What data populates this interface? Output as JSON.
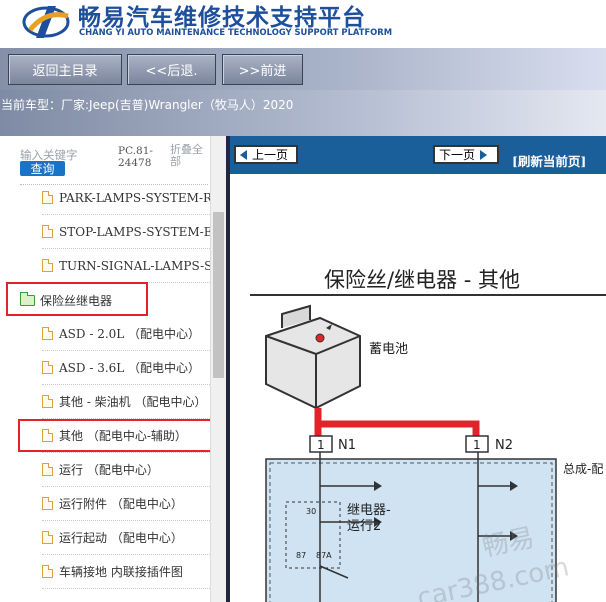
{
  "header": {
    "title": "畅易汽车维修技术支持平台",
    "subtitle": "CHANG YI AUTO MAINTENANCE TECHNOLOGY SUPPORT PLATFORM"
  },
  "toolbar": {
    "home_label": "返回主目录",
    "back_label": "<<后退.",
    "forward_label": ">>前进"
  },
  "model": {
    "prefix": "当前车型：",
    "text": "厂家:Jeep(吉普)Wrangler（牧马人）2020"
  },
  "search": {
    "label": "输入关键字",
    "code": "PC.81-24478",
    "collapse_label": "折叠全部",
    "query_label": "查询"
  },
  "tree": {
    "items": [
      {
        "label": "PARK-LAMPS-SYSTEM-R"
      },
      {
        "label": "STOP-LAMPS-SYSTEM-EX"
      },
      {
        "label": "TURN-SIGNAL-LAMPS-SY"
      },
      {
        "label": "保险丝继电器",
        "type": "folder"
      },
      {
        "label": "ASD - 2.0L （配电中心）"
      },
      {
        "label": "ASD - 3.6L （配电中心）"
      },
      {
        "label": "其他 - 柴油机 （配电中心）"
      },
      {
        "label": "其他 （配电中心-辅助）"
      },
      {
        "label": "运行 （配电中心）"
      },
      {
        "label": "运行附件 （配电中心）"
      },
      {
        "label": "运行起动 （配电中心）"
      },
      {
        "label": "车辆接地 内联接插件图"
      }
    ]
  },
  "nav": {
    "prev_label": "上一页",
    "next_label": "下一页",
    "refresh_label": "[刷新当前页]"
  },
  "diagram": {
    "title": "保险丝/继电器 - 其他",
    "battery_label": "蓄电池",
    "node1": "N1",
    "node2": "N2",
    "pin1": "1",
    "pin2": "1",
    "assembly_label": "总成-配",
    "relay_label_1": "继电器-",
    "relay_label_2": "运行2",
    "pin30": "30",
    "pin87": "87",
    "pin87a": "87A"
  },
  "watermark": {
    "line1": "畅易",
    "line2": "car388.com"
  },
  "colors": {
    "brand_blue": "#1d4f9c",
    "nav_blue": "#1a5e9a",
    "highlight_red": "#e0242a",
    "wire_red": "#e0242a"
  }
}
